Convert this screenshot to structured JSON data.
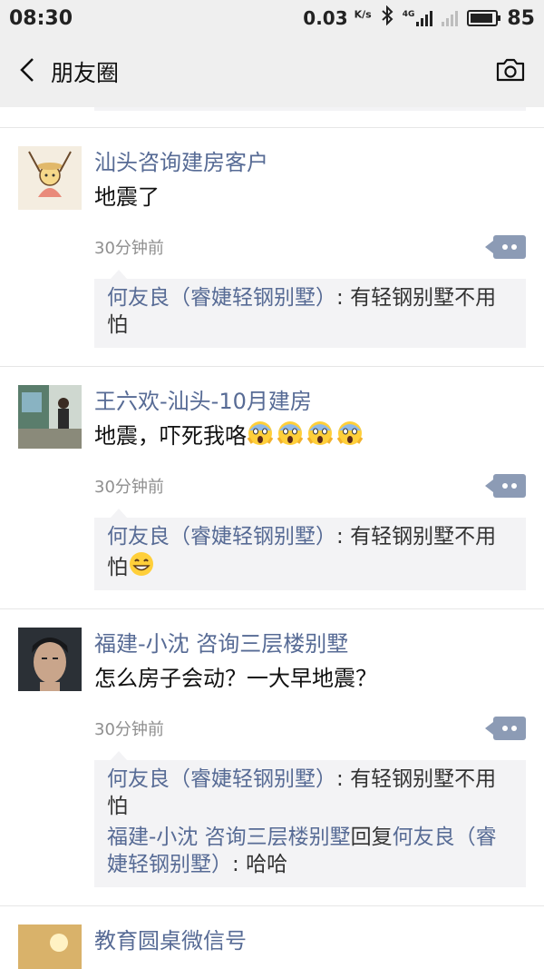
{
  "status_bar": {
    "time": "08:30",
    "speed_value": "0.03",
    "speed_unit": "K/s",
    "network": "4G",
    "battery": "85",
    "icons": [
      "bluetooth-icon",
      "signal-icon",
      "battery-icon"
    ]
  },
  "nav": {
    "back_icon": "chevron-left-icon",
    "title": "朋友圈",
    "camera_icon": "camera-icon"
  },
  "colors": {
    "name_link": "#576b95",
    "comment_bg": "#f3f3f5",
    "bar_bg": "#efefef",
    "more_btn": "#8c9bb5"
  },
  "posts": [
    {
      "author": "汕头咨询建房客户",
      "text": "地震了",
      "time": "30分钟前",
      "comments": [
        {
          "name": "何友良（睿婕轻钢别墅）",
          "sep": ": ",
          "text": "有轻钢别墅不用怕"
        }
      ]
    },
    {
      "author": "王六欢-汕头-10月建房",
      "text": "地震，吓死我咯",
      "emojis": [
        "scream-emoji",
        "scream-emoji",
        "scream-emoji",
        "scream-emoji"
      ],
      "time": "30分钟前",
      "comments": [
        {
          "name": "何友良（睿婕轻钢别墅）",
          "sep": ": ",
          "text": "有轻钢别墅不用怕",
          "emoji": "grin-emoji"
        }
      ]
    },
    {
      "author": "福建-小沈 咨询三层楼别墅",
      "text": "怎么房子会动？一大早地震？",
      "time": "30分钟前",
      "comments": [
        {
          "name": "何友良（睿婕轻钢别墅）",
          "sep": ": ",
          "text": "有轻钢别墅不用怕"
        },
        {
          "name": "福建-小沈 咨询三层楼别墅",
          "reply_word": "回复",
          "reply_to": "何友良（睿婕轻钢别墅）",
          "sep": ": ",
          "text": "哈哈"
        }
      ]
    },
    {
      "author": "教育圆桌微信号"
    }
  ]
}
